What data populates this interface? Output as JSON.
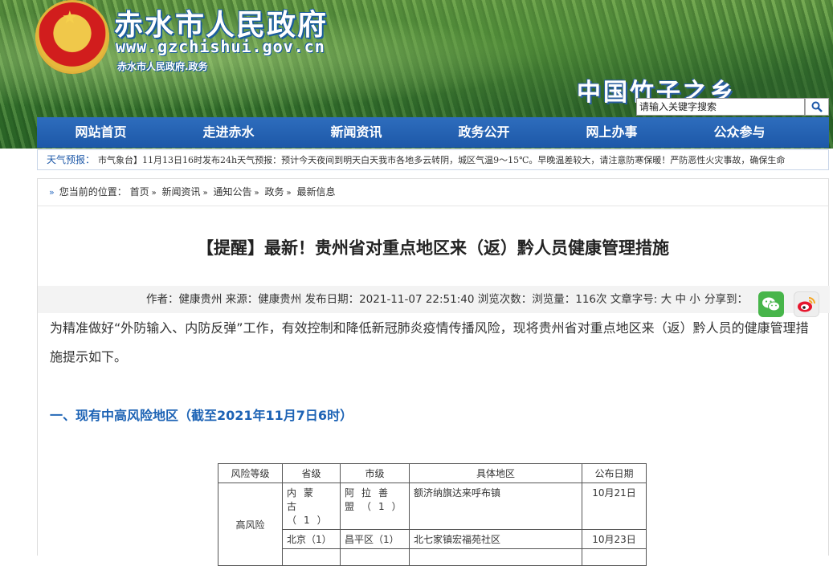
{
  "header": {
    "site_name": "赤水市人民政府",
    "site_url": "www.gzchishui.gov.cn",
    "site_sub": "赤水市人民政府.政务",
    "slogan": "中国竹子之乡",
    "colors": {
      "brand_blue": "#1d58a8",
      "heading_blue": "#1d63b5"
    }
  },
  "search": {
    "placeholder": "请输入关键字搜索",
    "icon": "search-icon"
  },
  "nav": {
    "items": [
      "网站首页",
      "走进赤水",
      "新闻资讯",
      "政务公开",
      "网上办事",
      "公众参与"
    ]
  },
  "weather": {
    "label": "天气预报：",
    "text": "市气象台】11月13日16时发布24h天气预报：预计今天夜间到明天白天我市各地多云转阴，城区气温9～15℃。早晚温差较大，请注意防寒保暖！严防恶性火灾事故，确保生命"
  },
  "breadcrumb": {
    "prefix": "您当前的位置：",
    "items": [
      "首页",
      "新闻资讯",
      "通知公告",
      "政务",
      "最新信息"
    ]
  },
  "article": {
    "title": "【提醒】最新！贵州省对重点地区来（返）黔人员健康管理措施",
    "meta": "作者：健康贵州  来源：健康贵州 发布日期：2021-11-07 22:51:40   浏览次数：浏览量：116次   文章字号: 大 中 小",
    "share_label": "分享到：",
    "intro": "为精准做好“外防输入、内防反弹”工作，有效控制和降低新冠肺炎疫情传播风险，现将贵州省对重点地区来（返）黔人员的健康管理措施提示如下。",
    "section1": "一、现有中高风险地区（截至2021年11月7日6时）"
  },
  "table": {
    "headers": [
      "风险等级",
      "省级",
      "市级",
      "具体地区",
      "公布日期"
    ],
    "rows": [
      {
        "level": "高风险",
        "province": "内蒙古（1）",
        "city": "阿拉善盟（1）",
        "area": "额济纳旗达来呼布镇",
        "date": "10月21日"
      },
      {
        "level": "",
        "province": "北京（1）",
        "city": "昌平区（1）",
        "area": "北七家镇宏福苑社区",
        "date": "10月23日"
      }
    ]
  }
}
